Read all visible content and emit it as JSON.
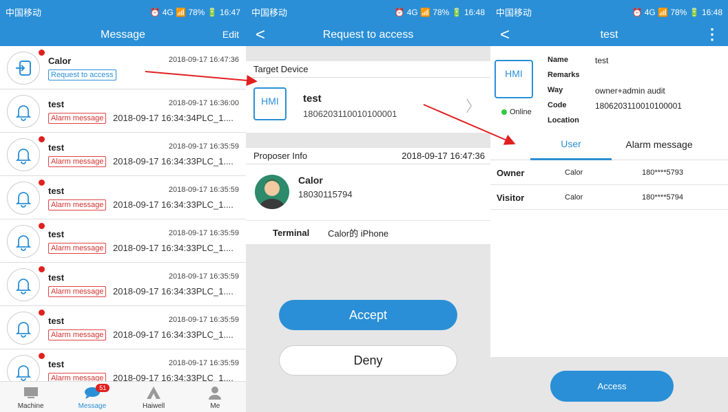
{
  "status": {
    "carrier": "中国移动",
    "p1_right": "⏰ 4G 📶 78% 🔋 16:47",
    "p2_right": "⏰ 4G 📶 78% 🔋 16:48",
    "p3_right": "⏰ 4G 📶 78% 🔋 16:48"
  },
  "p1": {
    "title": "Message",
    "edit": "Edit",
    "items": [
      {
        "title": "Calor",
        "time": "2018-09-17 16:47:36",
        "tag": "Request to access",
        "detail": ""
      },
      {
        "title": "test",
        "time": "2018-09-17 16:36:00",
        "tag": "Alarm message",
        "detail": "2018-09-17 16:34:34PLC_1...."
      },
      {
        "title": "test",
        "time": "2018-09-17 16:35:59",
        "tag": "Alarm message",
        "detail": "2018-09-17 16:34:33PLC_1...."
      },
      {
        "title": "test",
        "time": "2018-09-17 16:35:59",
        "tag": "Alarm message",
        "detail": "2018-09-17 16:34:33PLC_1...."
      },
      {
        "title": "test",
        "time": "2018-09-17 16:35:59",
        "tag": "Alarm message",
        "detail": "2018-09-17 16:34:33PLC_1...."
      },
      {
        "title": "test",
        "time": "2018-09-17 16:35:59",
        "tag": "Alarm message",
        "detail": "2018-09-17 16:34:33PLC_1...."
      },
      {
        "title": "test",
        "time": "2018-09-17 16:35:59",
        "tag": "Alarm message",
        "detail": "2018-09-17 16:34:33PLC_1...."
      },
      {
        "title": "test",
        "time": "2018-09-17 16:35:59",
        "tag": "Alarm message",
        "detail": "2018-09-17 16:34:33PLC_1...."
      }
    ],
    "tabs": [
      "Machine",
      "Message",
      "Haiwell",
      "Me"
    ],
    "badge": "51"
  },
  "p2": {
    "title": "Request to access",
    "back": "<",
    "target_label": "Target Device",
    "hmi": "HMI",
    "device_name": "test",
    "device_code": "1806203110010100001",
    "proposer_label": "Proposer Info",
    "proposer_time": "2018-09-17 16:47:36",
    "proposer_name": "Calor",
    "proposer_phone": "18030115794",
    "terminal_label": "Terminal",
    "terminal_value": "Calor的 iPhone",
    "accept": "Accept",
    "deny": "Deny"
  },
  "p3": {
    "title": "test",
    "back": "<",
    "more": "⋮",
    "hmi": "HMI",
    "online": "Online",
    "labels": [
      "Name",
      "Remarks",
      "Way",
      "Code",
      "Location"
    ],
    "values": [
      "test",
      "",
      "owner+admin audit",
      "1806203110010100001",
      ""
    ],
    "tabs": [
      "User",
      "Alarm message"
    ],
    "rows": [
      {
        "role": "Owner",
        "name": "Calor",
        "phone": "180****5793"
      },
      {
        "role": "Visitor",
        "name": "Calor",
        "phone": "180****5794"
      }
    ],
    "access": "Access"
  }
}
